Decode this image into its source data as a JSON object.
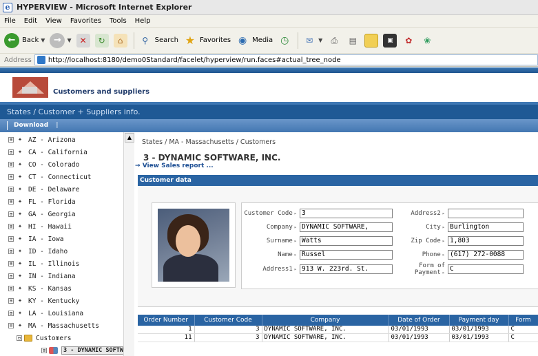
{
  "window": {
    "title": "HYPERVIEW - Microsoft Internet Explorer"
  },
  "menu": [
    "File",
    "Edit",
    "View",
    "Favorites",
    "Tools",
    "Help"
  ],
  "toolbar": {
    "back": "Back",
    "search": "Search",
    "favorites": "Favorites",
    "media": "Media"
  },
  "address": {
    "label": "Address",
    "url": "http://localhost:8180/demo0Standard/facelet/hyperview/run.faces#actual_tree_node"
  },
  "app": {
    "brand": "Customers and suppliers",
    "breadcrumb": "States / Customer + Suppliers info.",
    "download": "Download",
    "download_sep": "|"
  },
  "tree": {
    "items": [
      {
        "label": "AZ - Arizona",
        "expander": "⊞"
      },
      {
        "label": "CA - California",
        "expander": "⊞"
      },
      {
        "label": "CO - Colorado",
        "expander": "⊞"
      },
      {
        "label": "CT - Connecticut",
        "expander": "⊞"
      },
      {
        "label": "DE - Delaware",
        "expander": "⊞"
      },
      {
        "label": "FL - Florida",
        "expander": "⊞"
      },
      {
        "label": "GA - Georgia",
        "expander": "⊞"
      },
      {
        "label": "HI - Hawaii",
        "expander": "⊞"
      },
      {
        "label": "IA - Iowa",
        "expander": "⊞"
      },
      {
        "label": "ID - Idaho",
        "expander": "⊞"
      },
      {
        "label": "IL - Illinois",
        "expander": "⊞"
      },
      {
        "label": "IN - Indiana",
        "expander": "⊞"
      },
      {
        "label": "KS - Kansas",
        "expander": "⊞"
      },
      {
        "label": "KY - Kentucky",
        "expander": "⊞"
      },
      {
        "label": "LA - Louisiana",
        "expander": "⊞"
      },
      {
        "label": "MA - Massachusetts",
        "expander": "⊟"
      }
    ],
    "customers_label": "Customers",
    "selected_label": "3 - DYNAMIC SOFTW/"
  },
  "detail": {
    "breadcrumb": "States / MA - Massachusetts / Customers",
    "title": "3 - DYNAMIC SOFTWARE, INC.",
    "sales_link": "View Sales report ...",
    "section_title": "Customer data",
    "fields": {
      "customer_code": {
        "label": "Customer Code",
        "value": "3"
      },
      "company": {
        "label": "Company",
        "value": "DYNAMIC SOFTWARE,"
      },
      "surname": {
        "label": "Surname",
        "value": "Watts"
      },
      "name": {
        "label": "Name",
        "value": "Russel"
      },
      "address1": {
        "label": "Address1",
        "value": "913 W. 223rd. St."
      },
      "address2": {
        "label": "Address2",
        "value": ""
      },
      "city": {
        "label": "City",
        "value": "Burlington"
      },
      "zip": {
        "label": "Zip Code",
        "value": "1,803"
      },
      "phone": {
        "label": "Phone",
        "value": "(617) 272-0088"
      },
      "payment": {
        "label": "Form of Payment",
        "value": "C"
      }
    }
  },
  "orders": {
    "columns": [
      "Order Number",
      "Customer Code",
      "Company",
      "Date of Order",
      "Payment day",
      "Form"
    ],
    "rows": [
      [
        "1",
        "3",
        "DYNAMIC SOFTWARE, INC.",
        "03/01/1993",
        "03/01/1993",
        "C"
      ],
      [
        "11",
        "3",
        "DYNAMIC SOFTWARE, INC.",
        "03/01/1993",
        "03/01/1993",
        "C"
      ]
    ]
  }
}
